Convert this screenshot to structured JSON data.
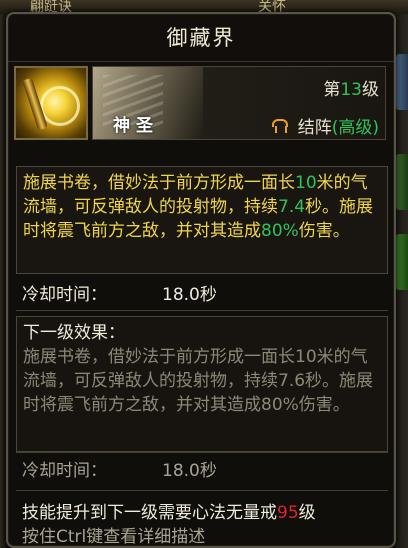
{
  "background": {
    "top_text_left": "翩跹诀",
    "top_text_right": "关怀"
  },
  "tooltip": {
    "title": "御藏界",
    "level_prefix": "第",
    "level_value": "13",
    "level_suffix": "级",
    "faction": "神圣",
    "skill_type": "结阵",
    "skill_grade": "(高级)",
    "icon_name": "golden-scroll-icon",
    "current_effect": {
      "p1": "施展书卷，借妙法于前方形成一面长",
      "length": "10",
      "p2": "米的气流墙，可反弹敌人的投射物，持续",
      "duration": "7.4",
      "p3": "秒。施展时将震飞前方之敌，并对其造成",
      "damage": "80%",
      "p4": "伤害。"
    },
    "cooldown_label": "冷却时间：",
    "cooldown_value": "18.0秒",
    "next_level": {
      "header": "下一级效果：",
      "text": "施展书卷，借妙法于前方形成一面长10米的气流墙，可反弹敌人的投射物，持续7.6秒。施展时将震飞前方之敌，并对其造成80%伤害。",
      "cooldown_label": "冷却时间：",
      "cooldown_value": "18.0秒"
    },
    "requirement": {
      "prefix": "技能提升到下一级需要心法无量戒",
      "level": "95",
      "suffix": "级"
    },
    "hint": "按住Ctrl键查看详细描述"
  },
  "colors": {
    "highlight_green": "#2ec45a",
    "effect_yellow": "#f0d64a",
    "requirement_red": "#e0242a",
    "skill_type_orange": "#f0a01e"
  }
}
